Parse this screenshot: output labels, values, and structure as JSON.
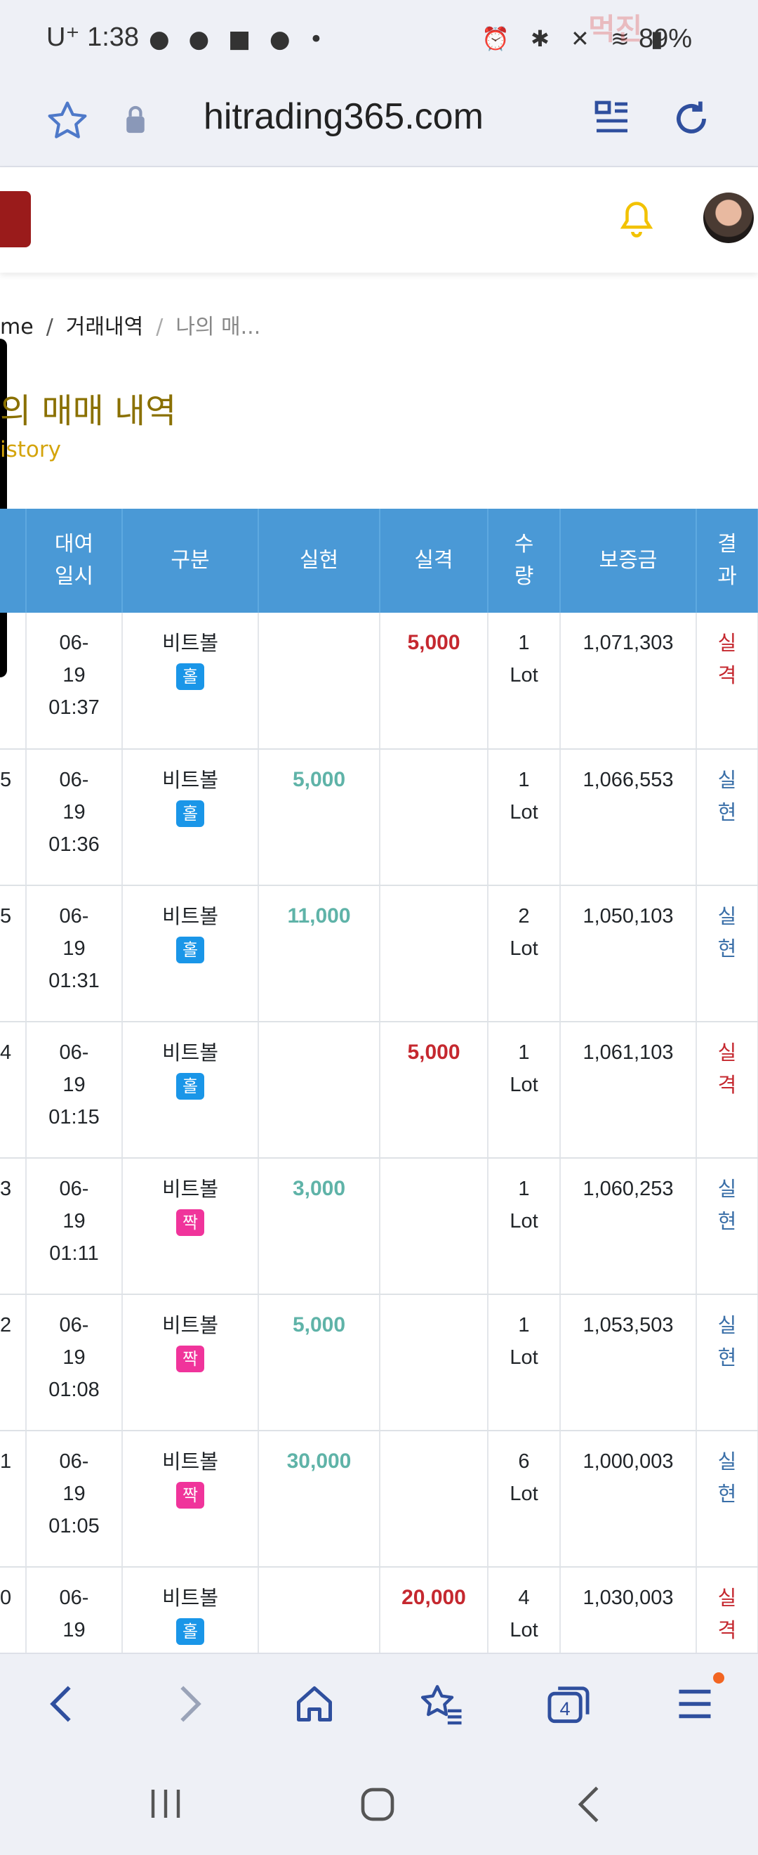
{
  "status": {
    "carrier": "U⁺",
    "time": "1:38",
    "notifications": "● ● ■ ● •",
    "right_icons": "⏰ ✱ ✕ ≋ ▮",
    "battery": "89%",
    "watermark": "먹진"
  },
  "browser": {
    "url": "hitrading365.com",
    "tab_count": "4"
  },
  "breadcrumb": {
    "home": "me",
    "history": "거래내역",
    "current": "나의 매..."
  },
  "page": {
    "title": "의 매매 내역",
    "subtitle": "istory"
  },
  "table": {
    "headers": {
      "time": [
        "대여",
        "일시"
      ],
      "type": "구분",
      "profit": "실현",
      "loss": "실격",
      "qty": [
        "수",
        "량"
      ],
      "deposit": "보증금",
      "result": [
        "결",
        "과"
      ]
    },
    "rows": [
      {
        "idx": "",
        "date": "06-",
        "day": "19",
        "time": "01:37",
        "name": "비트볼",
        "badge": "홀",
        "badge_color": "blue",
        "profit": "",
        "loss": "5,000",
        "qty": "1",
        "unit": "Lot",
        "deposit": "1,071,303",
        "result": [
          "실",
          "격"
        ],
        "result_type": "loss"
      },
      {
        "idx": "5",
        "date": "06-",
        "day": "19",
        "time": "01:36",
        "name": "비트볼",
        "badge": "홀",
        "badge_color": "blue",
        "profit": "5,000",
        "loss": "",
        "qty": "1",
        "unit": "Lot",
        "deposit": "1,066,553",
        "result": [
          "실",
          "현"
        ],
        "result_type": "profit"
      },
      {
        "idx": "5",
        "date": "06-",
        "day": "19",
        "time": "01:31",
        "name": "비트볼",
        "badge": "홀",
        "badge_color": "blue",
        "profit": "11,000",
        "loss": "",
        "qty": "2",
        "unit": "Lot",
        "deposit": "1,050,103",
        "result": [
          "실",
          "현"
        ],
        "result_type": "profit"
      },
      {
        "idx": "4",
        "date": "06-",
        "day": "19",
        "time": "01:15",
        "name": "비트볼",
        "badge": "홀",
        "badge_color": "blue",
        "profit": "",
        "loss": "5,000",
        "qty": "1",
        "unit": "Lot",
        "deposit": "1,061,103",
        "result": [
          "실",
          "격"
        ],
        "result_type": "loss"
      },
      {
        "idx": "3",
        "date": "06-",
        "day": "19",
        "time": "01:11",
        "name": "비트볼",
        "badge": "짝",
        "badge_color": "pink",
        "profit": "3,000",
        "loss": "",
        "qty": "1",
        "unit": "Lot",
        "deposit": "1,060,253",
        "result": [
          "실",
          "현"
        ],
        "result_type": "profit"
      },
      {
        "idx": "2",
        "date": "06-",
        "day": "19",
        "time": "01:08",
        "name": "비트볼",
        "badge": "짝",
        "badge_color": "pink",
        "profit": "5,000",
        "loss": "",
        "qty": "1",
        "unit": "Lot",
        "deposit": "1,053,503",
        "result": [
          "실",
          "현"
        ],
        "result_type": "profit"
      },
      {
        "idx": "1",
        "date": "06-",
        "day": "19",
        "time": "01:05",
        "name": "비트볼",
        "badge": "짝",
        "badge_color": "pink",
        "profit": "30,000",
        "loss": "",
        "qty": "6",
        "unit": "Lot",
        "deposit": "1,000,003",
        "result": [
          "실",
          "현"
        ],
        "result_type": "profit"
      },
      {
        "idx": "0",
        "date": "06-",
        "day": "19",
        "time": "",
        "name": "비트볼",
        "badge": "홀",
        "badge_color": "blue",
        "profit": "",
        "loss": "20,000",
        "qty": "4",
        "unit": "Lot",
        "deposit": "1,030,003",
        "result": [
          "실",
          "격"
        ],
        "result_type": "loss"
      }
    ]
  },
  "colors": {
    "header_blue": "#4a99d6",
    "profit_teal": "#5fb3a8",
    "loss_red": "#c5282f",
    "badge_blue": "#1a96e8",
    "badge_pink": "#f0349b",
    "title_olive": "#8a7000",
    "bell_yellow": "#f2c200"
  }
}
